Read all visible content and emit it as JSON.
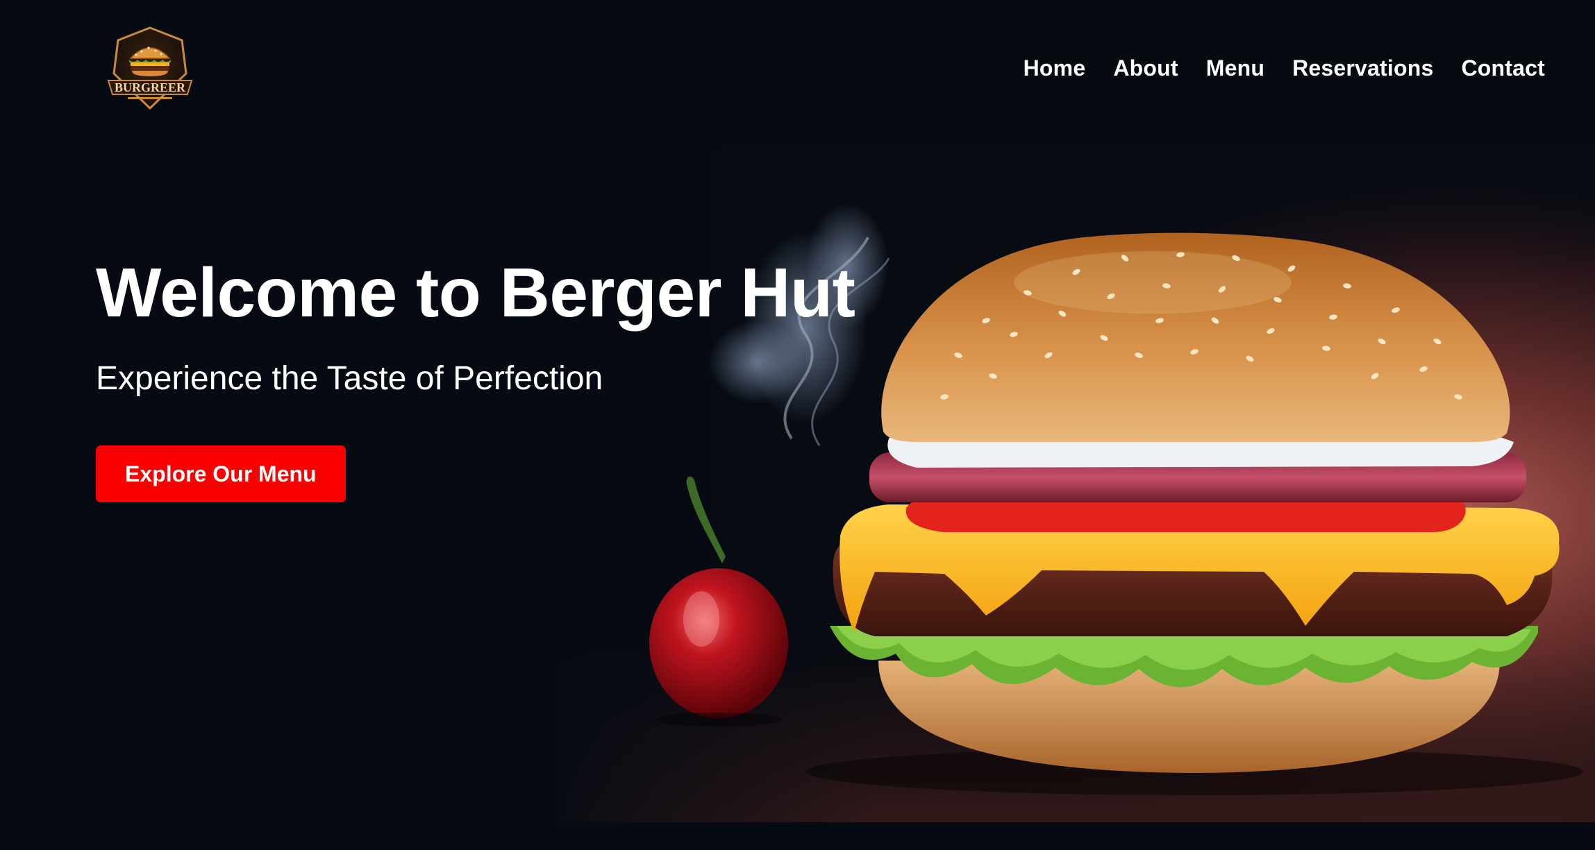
{
  "header": {
    "logo_text": "BURGREER",
    "nav": {
      "home": "Home",
      "about": "About",
      "menu": "Menu",
      "reservations": "Reservations",
      "contact": "Contact"
    }
  },
  "hero": {
    "title": "Welcome to Berger Hut",
    "subtitle": "Experience the Taste of Perfection",
    "cta_label": "Explore Our Menu",
    "image_subject": "burger-with-chili-pepper"
  },
  "colors": {
    "background": "#060b13",
    "accent": "#fb0000",
    "text": "#ffffff"
  }
}
